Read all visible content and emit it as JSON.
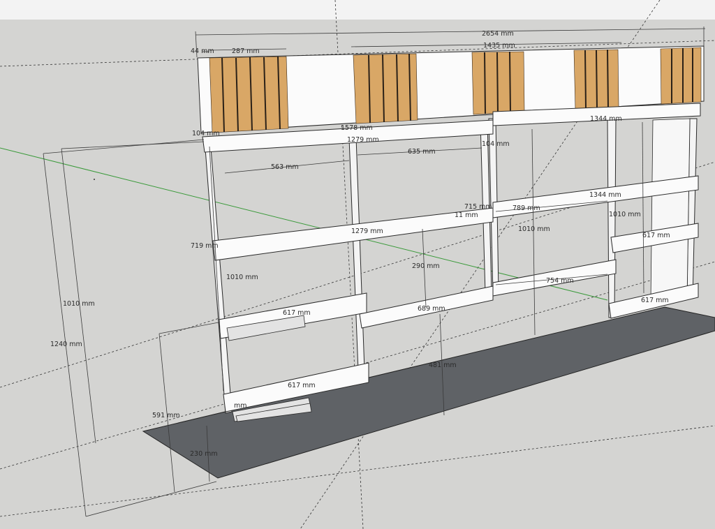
{
  "window": {
    "top_bar_color": "#f3f3f3",
    "background_color": "#d4d4d2",
    "floor_color": "#5f6266"
  },
  "dimensions": {
    "total_width": "2654 mm",
    "left_gap": "44 mm",
    "panel_width": "287 mm",
    "mid_span": "1435 mm",
    "top_beam_left": "1279 mm",
    "top_beam_right": "1344 mm",
    "beam_mid_left": "1279 mm",
    "beam_mid_right": "1344 mm",
    "span_563": "563 mm",
    "span_635": "635 mm",
    "span_789": "789 mm",
    "span_754": "754 mm",
    "span_689": "689 mm",
    "span_290": "290 mm",
    "shelf_617_a": "617 mm",
    "shelf_617_b": "617 mm",
    "shelf_617_c": "617 mm",
    "shelf_617_d": "617 mm",
    "height_1010_a": "1010 mm",
    "height_1010_b": "1010 mm",
    "height_1010_c": "1010 mm",
    "height_1010_d": "1010 mm",
    "height_1240": "1240 mm",
    "height_719": "719 mm",
    "height_591": "591 mm",
    "height_230": "230 mm",
    "height_481": "481 mm",
    "small_104": "104 mm",
    "small_1578": "1578 mm",
    "small_104b": "104 mm",
    "small_715": "715 mm",
    "small_11": "11 mm",
    "small_m": "mm"
  }
}
